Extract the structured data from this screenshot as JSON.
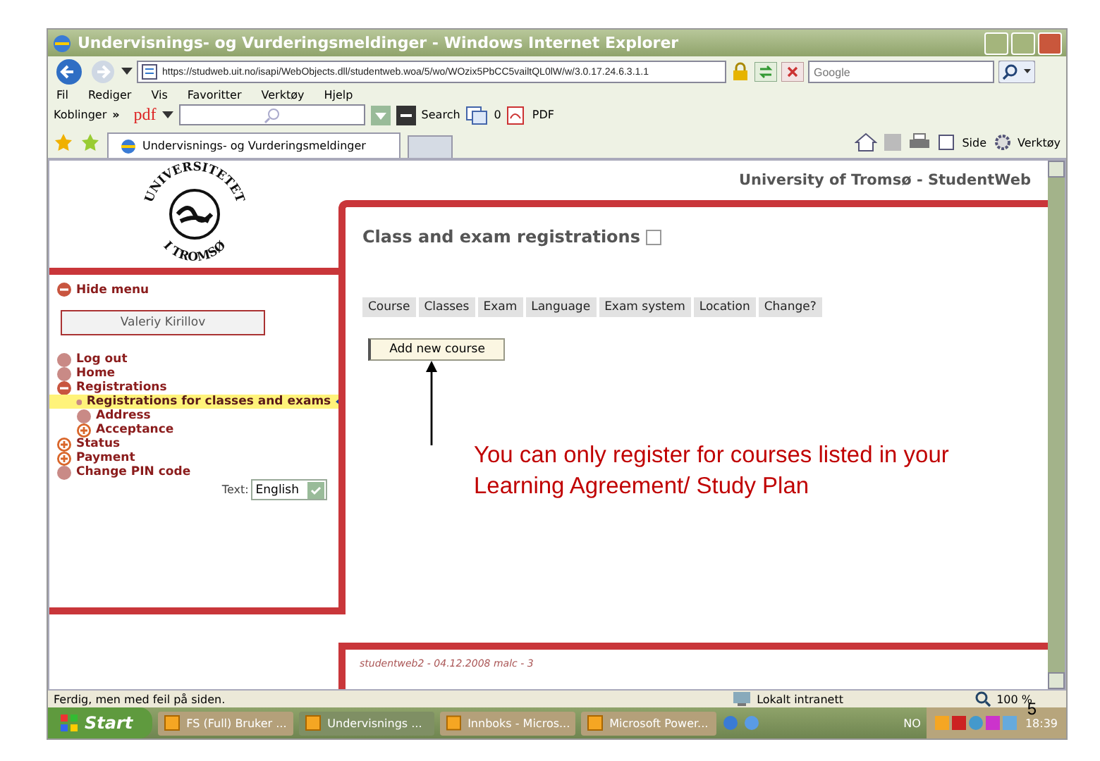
{
  "window": {
    "title": "Undervisnings- og Vurderingsmeldinger - Windows Internet Explorer"
  },
  "address_bar": {
    "value": "https://studweb.uit.no/isapi/WebObjects.dll/studentweb.woa/5/wo/WOzix5PbCC5vailtQL0lW/w/3.0.17.24.6.3.1.1"
  },
  "search": {
    "placeholder": "Google"
  },
  "menu_bar": [
    "Fil",
    "Rediger",
    "Vis",
    "Favoritter",
    "Verktøy",
    "Hjelp"
  ],
  "links_bar": {
    "label": "Koblinger",
    "more": "»",
    "pdf": "pdf",
    "search_button": "Search",
    "count": "0",
    "pdf_button": "PDF"
  },
  "tabs": [
    {
      "label": "Undervisnings- og Vurderingsmeldinger",
      "selected": true
    }
  ],
  "command_bar": [
    "Side",
    "Verktøy"
  ],
  "page": {
    "logo_text": "UNIVERSITETET I TROMSØ",
    "header": "University of Tromsø - StudentWeb",
    "hide_menu": "Hide menu",
    "user_button": "Valeriy Kirillov",
    "menu": [
      {
        "label": "Log out",
        "kind": "leaf",
        "selected": false
      },
      {
        "label": "Home",
        "kind": "leaf",
        "selected": false
      },
      {
        "label": "Registrations",
        "expanded": true,
        "kind": "folder",
        "selected": false,
        "children": [
          {
            "label": "Registrations for classes and exams",
            "kind": "leaf",
            "selected": true
          },
          {
            "label": "Address",
            "kind": "leaf",
            "selected": false
          },
          {
            "label": "Acceptance",
            "expanded": false,
            "kind": "folder",
            "selected": false
          }
        ]
      },
      {
        "label": "Status",
        "expanded": false,
        "kind": "folder",
        "selected": false
      },
      {
        "label": "Payment",
        "expanded": false,
        "kind": "folder",
        "selected": false
      },
      {
        "label": "Change PIN code",
        "kind": "leaf",
        "selected": false
      }
    ],
    "language": {
      "label": "Text:",
      "value": "English"
    },
    "title": "Class and exam registrations",
    "table": {
      "columns": [
        "Course",
        "Classes",
        "Exam",
        "Language",
        "Exam system",
        "Location",
        "Change?"
      ]
    },
    "add_button": "Add new course",
    "note": "You can only register for courses listed in your Learning Agreement/ Study Plan",
    "footer": "studentweb2 - 04.12.2008 malc - 3"
  },
  "status_bar": {
    "text": "Ferdig, men med feil på siden.",
    "zone": "Lokalt intranett",
    "zoom": "100 %"
  },
  "taskbar": {
    "start": "Start",
    "tasks": [
      {
        "label": "FS (Full) Bruker ...",
        "selected": false
      },
      {
        "label": "Undervisnings ...",
        "selected": true
      },
      {
        "label": "Innboks - Micros...",
        "selected": false
      },
      {
        "label": "Microsoft Power...",
        "selected": false
      }
    ],
    "language": "NO",
    "clock": "18:39"
  },
  "slide_number": "5"
}
